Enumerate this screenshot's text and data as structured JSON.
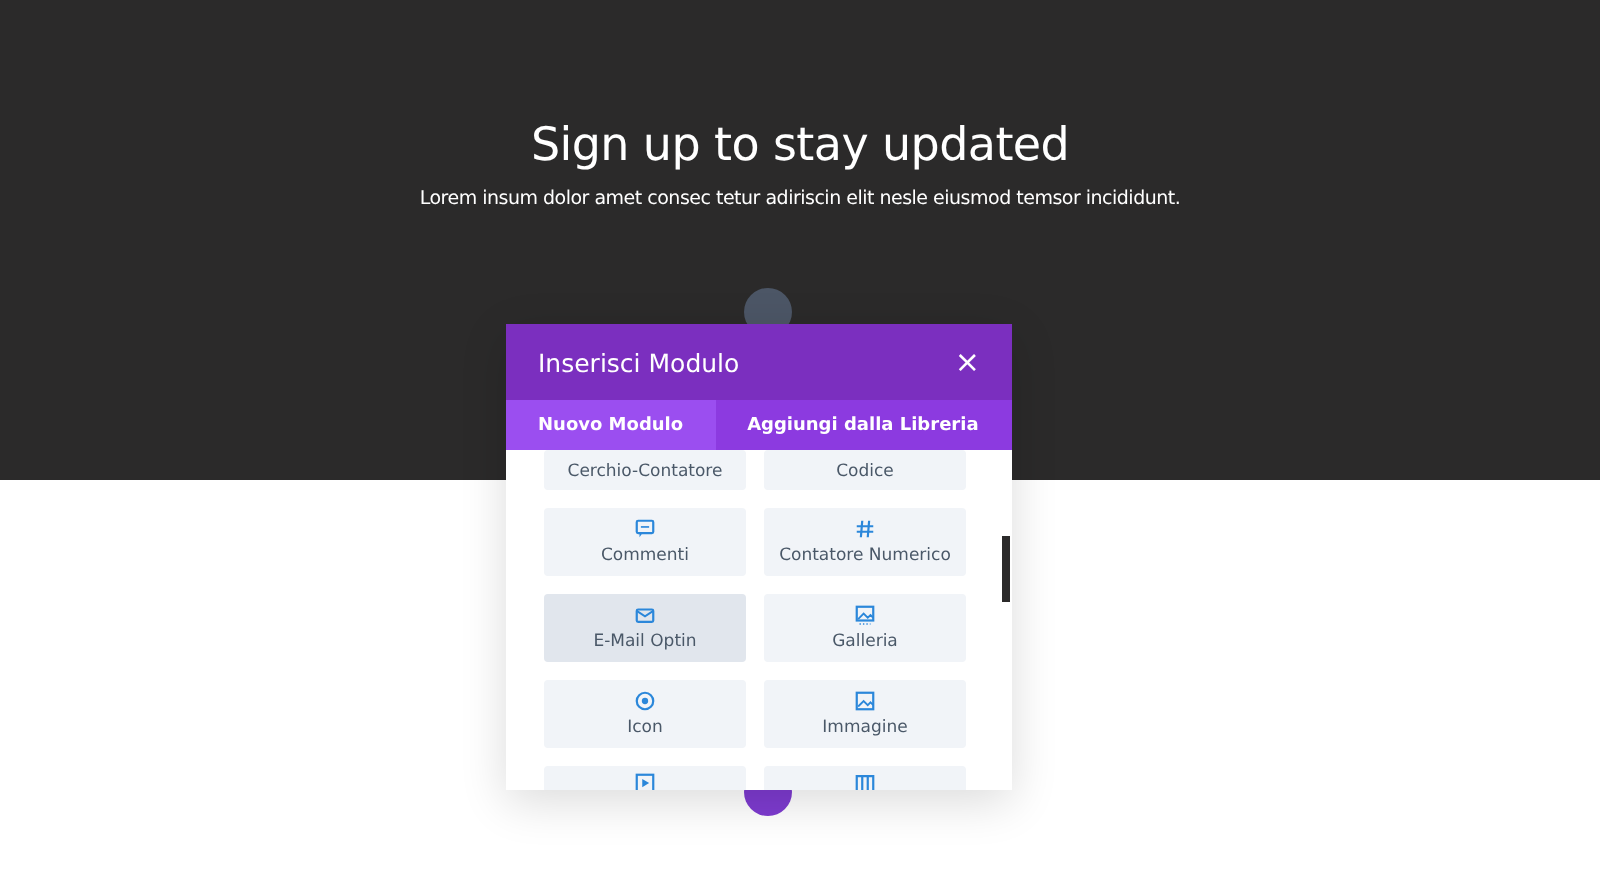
{
  "hero": {
    "title": "Sign up to stay updated",
    "subtitle": "Lorem insum dolor amet consec tetur adiriscin elit nesle eiusmod temsor incididunt."
  },
  "modal": {
    "title": "Inserisci Modulo",
    "close": "×",
    "tabs": [
      {
        "label": "Nuovo Modulo",
        "selected": true
      },
      {
        "label": "Aggiungi dalla Libreria",
        "selected": false
      }
    ],
    "modules": [
      {
        "label": "Cerchio-Contatore",
        "kind": "none",
        "selected": false
      },
      {
        "label": "Codice",
        "kind": "none",
        "selected": false
      },
      {
        "label": "Commenti",
        "kind": "comment",
        "selected": false
      },
      {
        "label": "Contatore Numerico",
        "kind": "hash",
        "selected": false
      },
      {
        "label": "E-Mail Optin",
        "kind": "mail",
        "selected": true
      },
      {
        "label": "Galleria",
        "kind": "gallery",
        "selected": false
      },
      {
        "label": "Icon",
        "kind": "target",
        "selected": false
      },
      {
        "label": "Immagine",
        "kind": "image",
        "selected": false
      },
      {
        "kind": "play",
        "selected": false
      },
      {
        "kind": "columns",
        "selected": false
      }
    ]
  }
}
